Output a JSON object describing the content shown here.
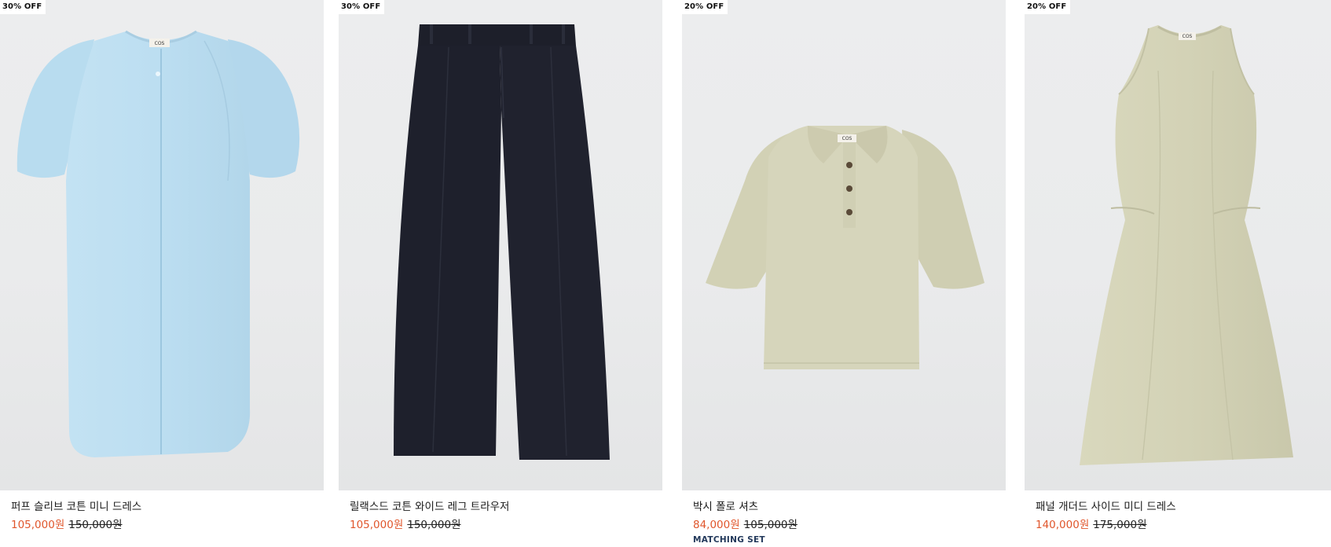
{
  "products": [
    {
      "badge": "30% OFF",
      "name": "퍼프 슬리브 코튼 미니 드레스",
      "sale_price": "105,000원",
      "original_price": "150,000원",
      "color": "#bfe0f2",
      "label": "COS"
    },
    {
      "badge": "30% OFF",
      "name": "릴랙스드 코튼 와이드 레그 트라우저",
      "sale_price": "105,000원",
      "original_price": "150,000원",
      "color": "#20222d"
    },
    {
      "badge": "20% OFF",
      "name": "박시 폴로 셔츠",
      "sale_price": "84,000원",
      "original_price": "105,000원",
      "tag": "MATCHING SET",
      "color": "#d5d4b9",
      "label": "COS"
    },
    {
      "badge": "20% OFF",
      "name": "패널 개더드 사이드 미디 드레스",
      "sale_price": "140,000원",
      "original_price": "175,000원",
      "color": "#d3d2b6",
      "label": "COS"
    }
  ],
  "colors": {
    "sale": "#e0562c",
    "tag": "#23395b",
    "background": "#ebecec"
  }
}
